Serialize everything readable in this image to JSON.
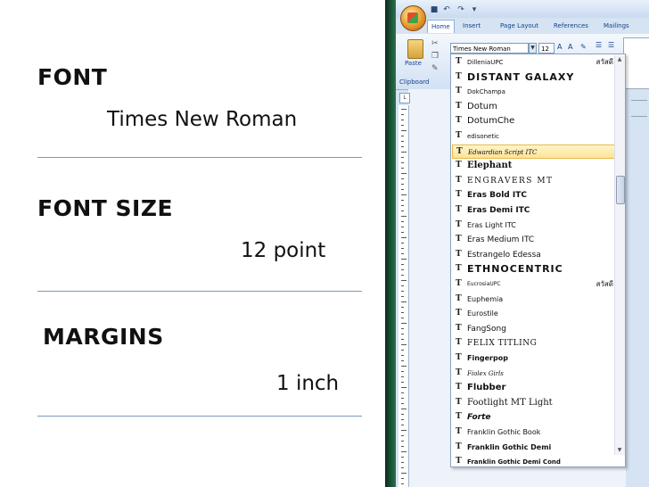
{
  "slide": {
    "font_heading": "FONT",
    "font_value": "Times New Roman",
    "size_heading": "FONT SIZE",
    "size_value": "12 point",
    "margins_heading": "MARGINS",
    "margins_value": "1 inch"
  },
  "word": {
    "tabs": [
      "Home",
      "Insert",
      "Page Layout",
      "References",
      "Mailings"
    ],
    "active_tab": "Home",
    "paste_label": "Paste",
    "clipboard_label": "Clipboard",
    "font_box_value": "Times New Roman",
    "size_box_value": "12",
    "ruler_button": "L",
    "accent_color": "#15428b"
  },
  "font_list": [
    {
      "name": "DilleniaUPC",
      "sample": "สวัสดี"
    },
    {
      "name": "DISTANT GALAXY"
    },
    {
      "name": "DokChampa"
    },
    {
      "name": "Dotum"
    },
    {
      "name": "DotumChe"
    },
    {
      "name": "edisonetic"
    },
    {
      "name": "Edwardian Script ITC"
    },
    {
      "name": "Elephant"
    },
    {
      "name": "ENGRAVERS MT"
    },
    {
      "name": "Eras Bold ITC"
    },
    {
      "name": "Eras Demi ITC"
    },
    {
      "name": "Eras Light ITC"
    },
    {
      "name": "Eras Medium ITC"
    },
    {
      "name": "Estrangelo Edessa"
    },
    {
      "name": "ETHNOCENTRIC"
    },
    {
      "name": "EucrosiaUPC",
      "sample": "สวัสดี"
    },
    {
      "name": "Euphemia"
    },
    {
      "name": "Eurostile"
    },
    {
      "name": "FangSong"
    },
    {
      "name": "FELIX TITLING"
    },
    {
      "name": "Fingerpop"
    },
    {
      "name": "Fiolex Girls"
    },
    {
      "name": "Flubber"
    },
    {
      "name": "Footlight MT Light"
    },
    {
      "name": "Forte"
    },
    {
      "name": "Franklin Gothic Book"
    },
    {
      "name": "Franklin Gothic Demi"
    },
    {
      "name": "Franklin Gothic Demi Cond"
    }
  ]
}
